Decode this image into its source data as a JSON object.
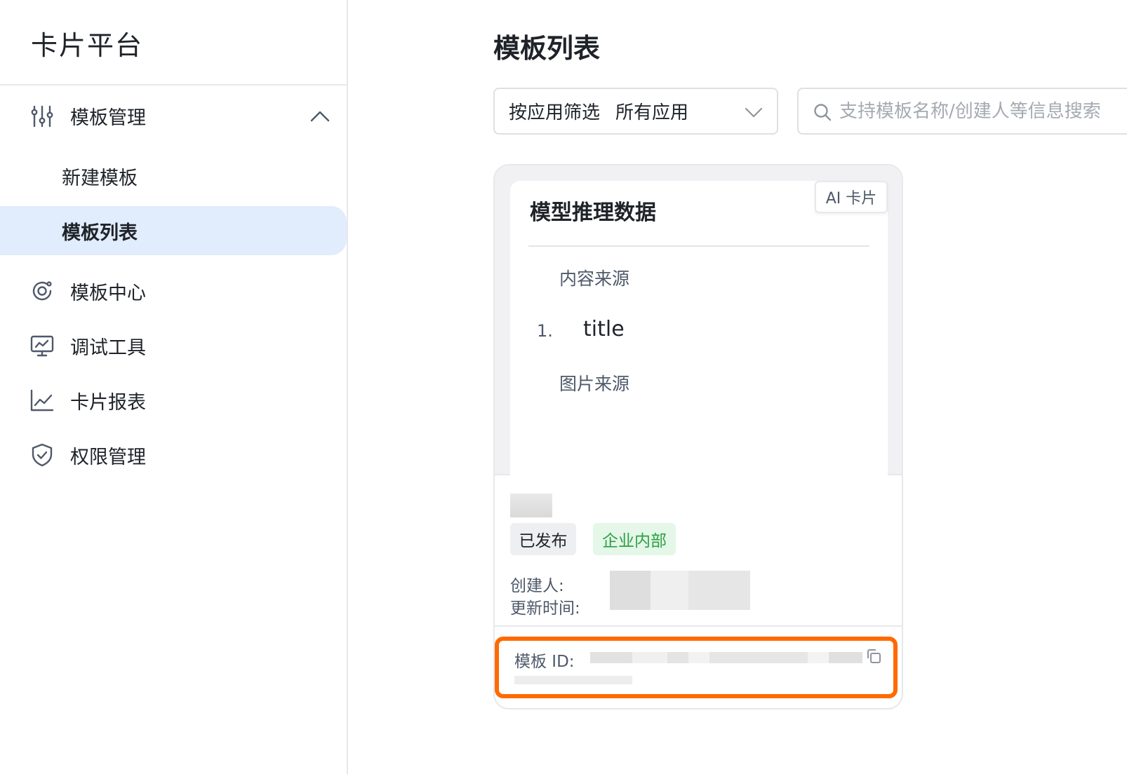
{
  "sidebar": {
    "brand": "卡片平台",
    "group": {
      "label": "模板管理",
      "icon": "sliders-icon",
      "expanded": true
    },
    "sub_items": [
      {
        "label": "新建模板",
        "active": false
      },
      {
        "label": "模板列表",
        "active": true
      }
    ],
    "items": [
      {
        "label": "模板中心",
        "icon": "template-center-icon"
      },
      {
        "label": "调试工具",
        "icon": "monitor-icon"
      },
      {
        "label": "卡片报表",
        "icon": "line-chart-icon"
      },
      {
        "label": "权限管理",
        "icon": "shield-check-icon"
      }
    ]
  },
  "main": {
    "title": "模板列表",
    "filter": {
      "label": "按应用筛选",
      "value": "所有应用"
    },
    "search": {
      "placeholder": "支持模板名称/创建人等信息搜索"
    }
  },
  "card": {
    "preview_title": "模型推理数据",
    "badge": "AI 卡片",
    "section1": "内容来源",
    "list_number": "1.",
    "list_text": "title",
    "section2": "图片来源",
    "status_tag": "已发布",
    "scope_tag": "企业内部",
    "creator_label": "创建人:",
    "updated_label": "更新时间:",
    "id_label": "模板 ID:"
  },
  "colors": {
    "active_bg": "#e1ecfd",
    "highlight_border": "#ff6a00",
    "scope_tag_text": "#2ea043",
    "scope_tag_bg": "#e4f7e8"
  }
}
